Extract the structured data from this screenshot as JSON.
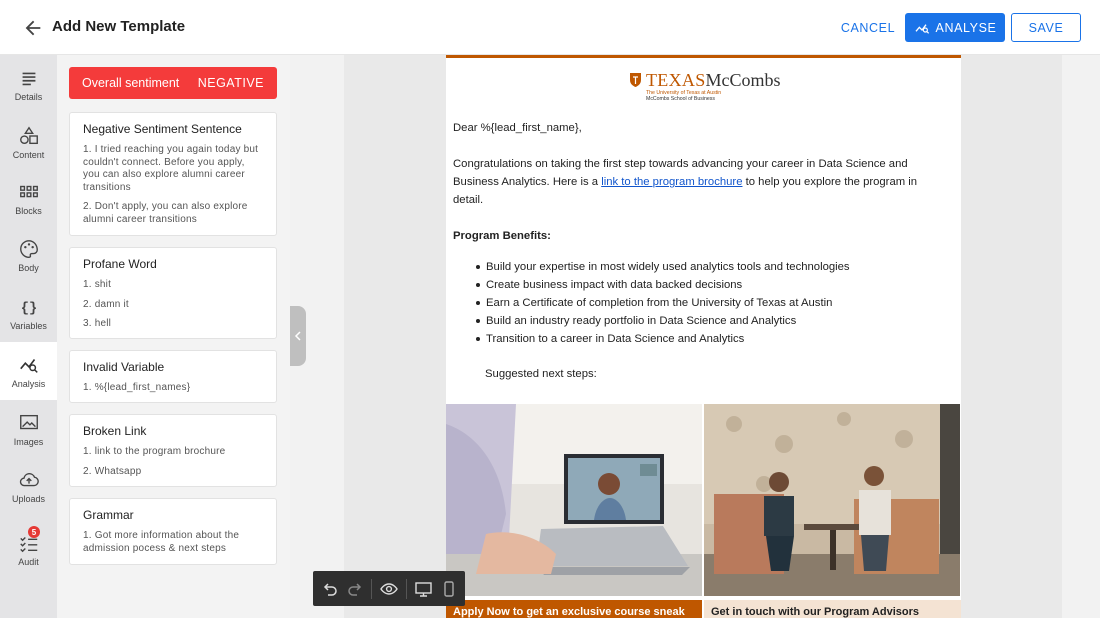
{
  "header": {
    "title": "Add New Template",
    "cancel_label": "CANCEL",
    "analyse_label": "ANALYSE",
    "save_label": "SAVE"
  },
  "rail": {
    "items": [
      {
        "label": "Details",
        "icon": "details-icon"
      },
      {
        "label": "Content",
        "icon": "shapes-icon"
      },
      {
        "label": "Blocks",
        "icon": "grid-icon"
      },
      {
        "label": "Body",
        "icon": "palette-icon"
      },
      {
        "label": "Variables",
        "icon": "braces-icon"
      },
      {
        "label": "Analysis",
        "icon": "analysis-icon"
      },
      {
        "label": "Images",
        "icon": "image-icon"
      },
      {
        "label": "Uploads",
        "icon": "cloud-upload-icon"
      },
      {
        "label": "Audit",
        "icon": "checklist-icon",
        "badge": "5"
      }
    ]
  },
  "panel": {
    "sentiment_label": "Overall sentiment",
    "sentiment_value": "NEGATIVE",
    "cards": [
      {
        "title": "Negative Sentiment Sentence",
        "items": [
          "1. I tried reaching you again today but couldn't connect. Before you apply, you can also explore alumni career transitions",
          "2. Don't apply, you can also explore alumni career transitions"
        ]
      },
      {
        "title": "Profane Word",
        "items": [
          "1. shit",
          "2. damn it",
          "3. hell"
        ]
      },
      {
        "title": "Invalid Variable",
        "items": [
          "1. %{lead_first_names}"
        ]
      },
      {
        "title": "Broken Link",
        "items": [
          "1. link to the program brochure",
          "2. Whatsapp"
        ]
      },
      {
        "title": "Grammar",
        "items": [
          "1. Got more information about the admission pocess & next steps"
        ]
      }
    ]
  },
  "email": {
    "logo_main_1": "TEXAS",
    "logo_main_2": "McCombs",
    "logo_sub_1": "The University of Texas at Austin",
    "logo_sub_2": "McCombs School of Business",
    "greeting": "Dear %{lead_first_name},",
    "para_start": "Congratulations on taking the first step towards advancing your career in Data Science and Business Analytics.  Here is a ",
    "para_link": "link to the program brochure",
    "para_end": " to help you explore the program in detail.",
    "benefits_heading": "Program Benefits:",
    "benefits": [
      "Build your expertise in most widely used analytics tools and technologies",
      "Create business impact with data backed decisions",
      "Earn a Certificate of completion from the University of Texas at Austin",
      "Build an industry ready portfolio in Data Science and Analytics",
      "Transition to a career in Data Science and Analytics"
    ],
    "next_steps": "Suggested next steps:",
    "caption_left": "Apply Now to get an exclusive course sneak",
    "caption_right": "Get in touch with our Program Advisors"
  },
  "colors": {
    "accent": "#1a73e8",
    "negative": "#f43b3b",
    "texas_orange": "#bf5700",
    "caption_left_bg": "#bf5700",
    "caption_right_bg": "#f4e3d3"
  }
}
